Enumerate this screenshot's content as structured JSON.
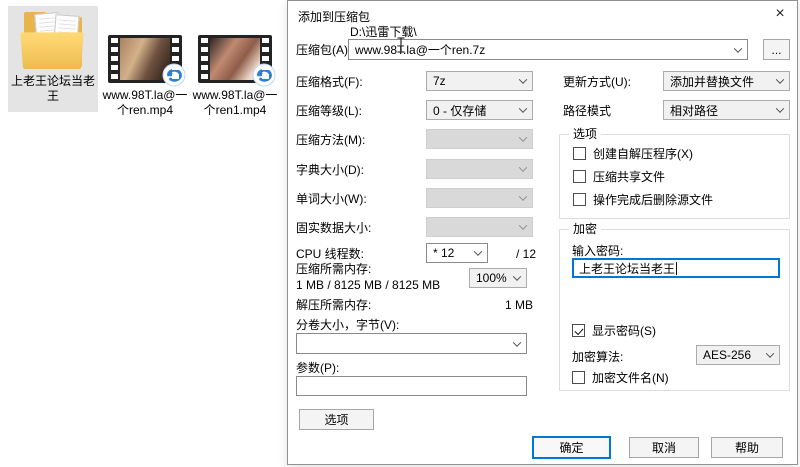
{
  "desktop": {
    "folder": {
      "label": "上老王论坛当老王"
    },
    "videos": [
      {
        "label": "www.98T.la@一个ren.mp4"
      },
      {
        "label": "www.98T.la@一个ren1.mp4"
      }
    ]
  },
  "dialog": {
    "title": "添加到压缩包",
    "close": "×",
    "archive": {
      "label": "压缩包(A)",
      "directory": "D:\\迅雷下载\\",
      "filename": "www.98T.la@一个ren.7z",
      "browse_label": "..."
    },
    "left": {
      "rows": [
        {
          "label": "压缩格式(F):",
          "value": "7z",
          "disabled": false
        },
        {
          "label": "压缩等级(L):",
          "value": "0 - 仅存储",
          "disabled": false
        },
        {
          "label": "压缩方法(M):",
          "value": "",
          "disabled": true
        },
        {
          "label": "字典大小(D):",
          "value": "",
          "disabled": true
        },
        {
          "label": "单词大小(W):",
          "value": "",
          "disabled": true
        },
        {
          "label": "固实数据大小:",
          "value": "",
          "disabled": true
        }
      ],
      "cpu": {
        "label": "CPU 线程数:",
        "value": "* 12",
        "suffix": "/ 12"
      },
      "memory": {
        "label": "压缩所需内存:",
        "detail": "1 MB / 8125 MB / 8125 MB",
        "percent": "100%"
      },
      "decompress": {
        "label": "解压所需内存:",
        "value": "1 MB"
      },
      "volume": {
        "label": "分卷大小，字节(V):",
        "value": ""
      },
      "params": {
        "label": "参数(P):",
        "value": ""
      },
      "options_button": "选项"
    },
    "right": {
      "update": {
        "label": "更新方式(U):",
        "value": "添加并替换文件"
      },
      "path": {
        "label": "路径模式",
        "value": "相对路径"
      },
      "options_group": {
        "title": "选项",
        "checkboxes": [
          {
            "label": "创建自解压程序(X)",
            "checked": false
          },
          {
            "label": "压缩共享文件",
            "checked": false
          },
          {
            "label": "操作完成后删除源文件",
            "checked": false
          }
        ]
      },
      "encryption_group": {
        "title": "加密",
        "password_label": "输入密码:",
        "password_value": "上老王论坛当老王",
        "show_password": {
          "label": "显示密码(S)",
          "checked": true
        },
        "method_label": "加密算法:",
        "method_value": "AES-256",
        "encrypt_names": {
          "label": "加密文件名(N)",
          "checked": false
        }
      }
    },
    "buttons": {
      "ok": "确定",
      "cancel": "取消",
      "help": "帮助"
    }
  },
  "colors": {
    "accent": "#0078d7",
    "selection_bg": "#e4e4e4",
    "disabled_fill": "#d9d9d9",
    "overlay_blue": "#2f7fd6",
    "folder_yellow": "#e9b44c"
  }
}
